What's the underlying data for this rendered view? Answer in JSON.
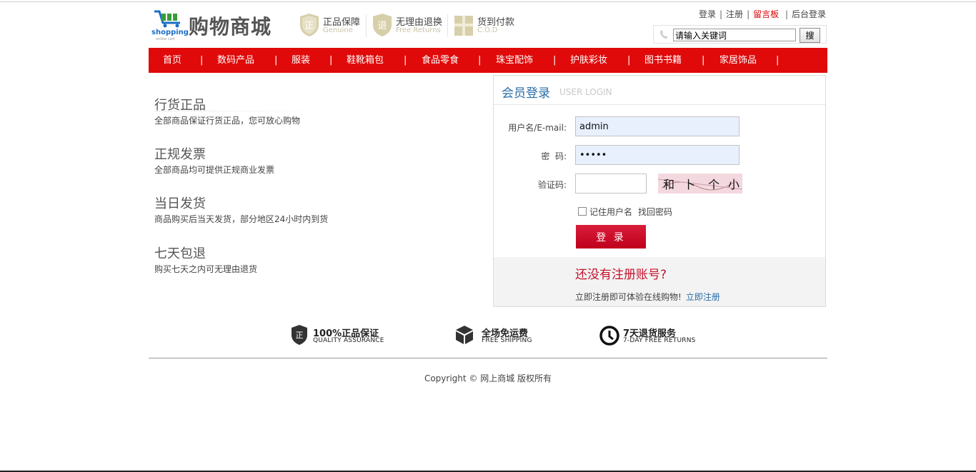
{
  "header": {
    "logo_text": "购物商城",
    "logo_sub": "shopping",
    "logo_sub2": "online cart",
    "badges": [
      {
        "icon": "genuine-shield-icon",
        "glyph": "正",
        "title": "正品保障",
        "subtitle": "Genuine"
      },
      {
        "icon": "returns-shield-icon",
        "glyph": "退",
        "title": "无理由退换",
        "subtitle": "Free Returns"
      },
      {
        "icon": "gift-box-icon",
        "glyph": "",
        "title": "货到付款",
        "subtitle": "C.O.D"
      }
    ],
    "links": {
      "login": "登录",
      "register": "注册",
      "guestbook": "留言板",
      "admin": "后台登录"
    },
    "search": {
      "value": "请输入关键词",
      "button": "搜"
    }
  },
  "nav": {
    "items": [
      "首页",
      "数码产品",
      "服装",
      "鞋靴箱包",
      "食品零食",
      "珠宝配饰",
      "护肤彩妆",
      "图书书籍",
      "家居饰品"
    ]
  },
  "features": [
    {
      "title": "行货正品",
      "desc": "全部商品保证行货正品，您可放心购物"
    },
    {
      "title": "正规发票",
      "desc": "全部商品均可提供正规商业发票"
    },
    {
      "title": "当日发货",
      "desc": "商品购买后当天发货，部分地区24小时内到货"
    },
    {
      "title": "七天包退",
      "desc": "购买七天之内可无理由退货"
    }
  ],
  "login": {
    "title": "会员登录",
    "subtitle": "USER LOGIN",
    "username_label": "用户名/E-mail:",
    "username_value": "admin",
    "password_label": "密  码:",
    "password_value": "•••••",
    "captcha_label": "验证码:",
    "captcha_chars": [
      "和",
      "卜",
      "个",
      "小"
    ],
    "remember_label": "记住用户名",
    "forgot_label": "找回密码",
    "submit_label": "登 录",
    "register_question": "还没有注册账号?",
    "register_text": "立即注册即可体验在线购物!",
    "register_link": "立即注册"
  },
  "services": [
    {
      "icon": "quality-shield-icon",
      "title": "100%正品保证",
      "subtitle": "QUALITY ASSURANCE"
    },
    {
      "icon": "shipping-box-icon",
      "title": "全场免运费",
      "subtitle": "FREE SHIPPING"
    },
    {
      "icon": "clock-icon",
      "title": "7天退货服务",
      "subtitle": "7-DAY FREE RETURNS"
    }
  ],
  "footer": {
    "copyright": "Copyright © 网上商城 版权所有"
  },
  "colors": {
    "nav_bg": "#e00a0a",
    "accent_red": "#c4112b",
    "link_blue": "#2a6da8"
  }
}
